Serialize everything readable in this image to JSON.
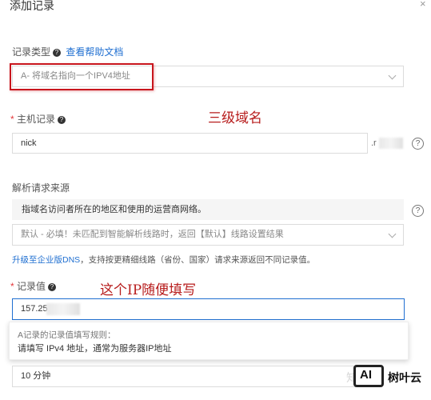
{
  "dialog": {
    "title": "添加记录",
    "close_glyph": "×"
  },
  "record_type": {
    "label": "记录类型",
    "help_link": "查看帮助文档",
    "value": "A- 将域名指向一个IPV4地址"
  },
  "host": {
    "label": "主机记录",
    "value": "nick",
    "suffix": ".r",
    "annotation": "三级域名"
  },
  "resolve_source": {
    "label": "解析请求来源",
    "hint": "指域名访问者所在的地区和使用的运营商网络。",
    "value": "默认 - 必填！未匹配到智能解析线路时，返回【默认】线路设置结果",
    "upgrade_link": "升级至企业版DNS",
    "upgrade_text": "，支持按更精细线路（省份、国家）请求来源返回不同记录值。"
  },
  "record_value": {
    "label": "记录值",
    "value": "157.255",
    "annotation": "这个IP随便填写",
    "tooltip_title": "A记录的记录值填写规则：",
    "tooltip_text": "请填写 IPv4 地址，通常为服务器IP地址"
  },
  "ttl": {
    "value": "10 分钟"
  },
  "watermark": {
    "left_text": "知乎",
    "logo_text": "AI",
    "brand_text": "树叶云"
  },
  "colors": {
    "accent": "#1f6fd1",
    "required": "#e4393c",
    "highlight_box": "#c8161d"
  }
}
